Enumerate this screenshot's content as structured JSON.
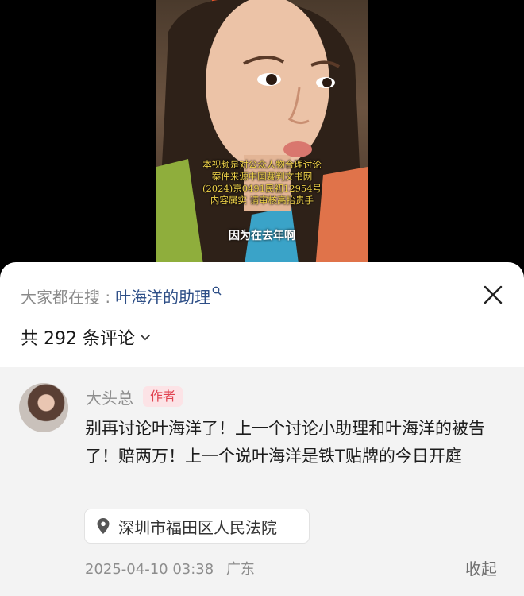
{
  "video": {
    "caption_lines": [
      "本视频是对公众人物合理讨论",
      "案件来源中国裁判文书网",
      "(2024)京0491民初12954号",
      "内容属实 请审核高抬贵手"
    ],
    "subtitle": "因为在去年啊"
  },
  "search": {
    "prefix": "大家都在搜 :",
    "term": "叶海洋的助理",
    "icon": "search-icon"
  },
  "comments_header": {
    "count_text": "共 292 条评论",
    "icon": "chevron-down-icon"
  },
  "comment": {
    "author": "大头总",
    "badge": "作者",
    "text": "别再讨论叶海洋了！上一个讨论小助理和叶海洋的被告了！赔两万！上一个说叶海洋是铁T贴牌的今日开庭",
    "location": "深圳市福田区人民法院",
    "timestamp": "2025-04-10 03:38",
    "region": "广东",
    "collapse_label": "收起"
  },
  "colors": {
    "search_term": "#2e4f87",
    "badge_text": "#e0414f",
    "badge_bg": "#fce3e6",
    "comment_bg": "#f3f3f3"
  }
}
